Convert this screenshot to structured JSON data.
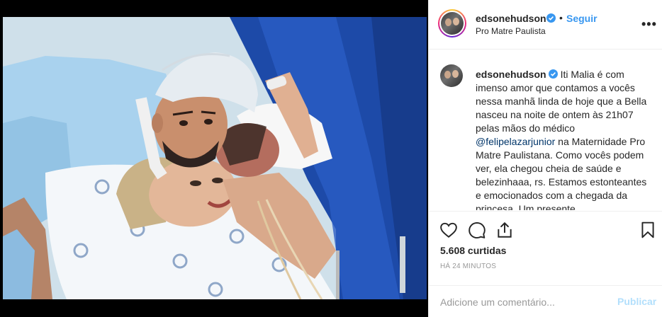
{
  "post": {
    "username": "edsonehudson",
    "verified": true,
    "separator": "•",
    "follow_label": "Seguir",
    "location": "Pro Matre Paulista",
    "more_label": "•••"
  },
  "caption": {
    "username": "edsonehudson",
    "text_before_mention": "Iti Malia é com imenso amor que contamos a vocês nessa manhã linda de hoje que a Bella nasceu na noite de ontem às 21h07 pelas mãos do médico ",
    "mention": "@felipelazarjunior",
    "text_after_mention": " na Maternidade Pro Matre Paulistana. Como vocês podem ver, ela chegou cheia de saúde e belezinhaaa, rs. Estamos estonteantes e emocionados com a chegada da princesa. Um presente"
  },
  "actions": {
    "like_icon": "heart-icon",
    "comment_icon": "comment-icon",
    "share_icon": "share-icon",
    "save_icon": "bookmark-icon"
  },
  "likes": "5.608 curtidas",
  "time_ago": "HÁ 24 MINUTOS",
  "comment": {
    "placeholder": "Adicione um comentário...",
    "value": "",
    "publish_label": "Publicar"
  },
  "colors": {
    "link_blue": "#3897f0",
    "mention_blue": "#003569",
    "publish_disabled": "#b2dffc",
    "border": "#efefef"
  }
}
